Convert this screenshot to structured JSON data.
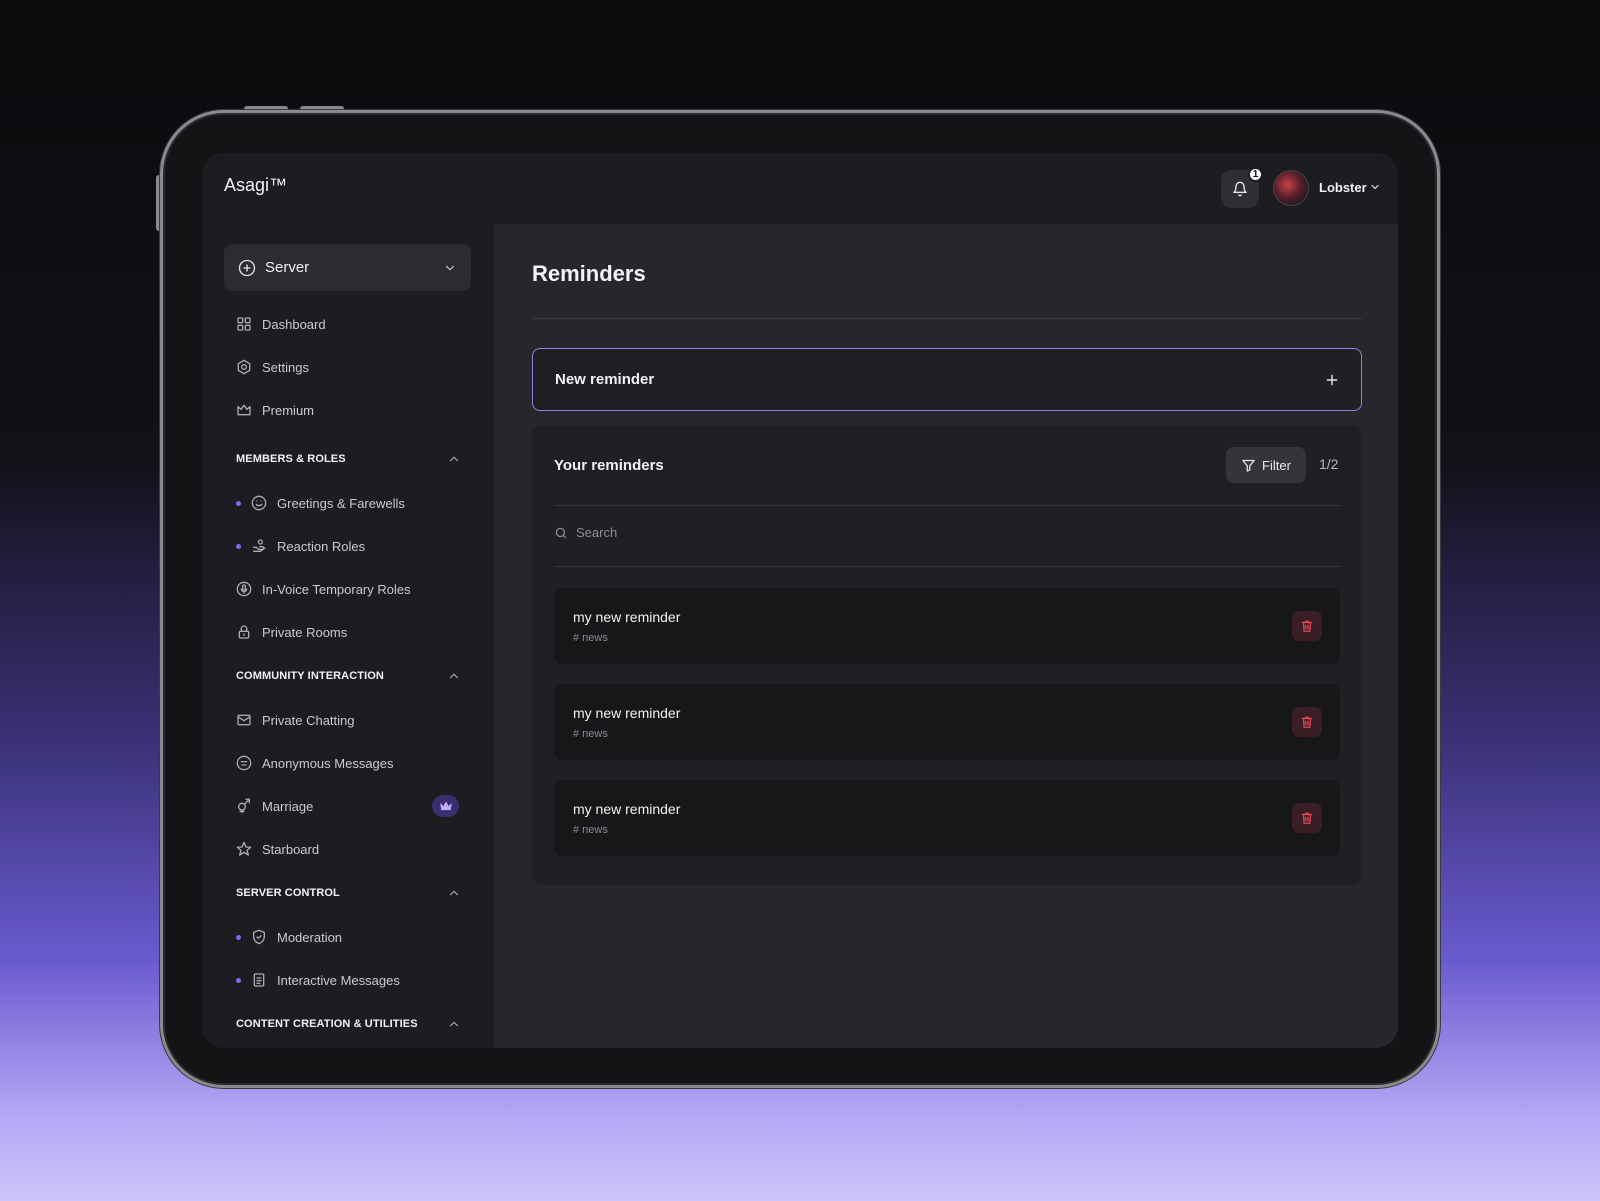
{
  "app": {
    "title": "Asagi™"
  },
  "header": {
    "notification_count": "1",
    "username": "Lobster"
  },
  "sidebar": {
    "server_select": "Server",
    "top_items": [
      {
        "label": "Dashboard",
        "icon": "grid-icon"
      },
      {
        "label": "Settings",
        "icon": "gear-icon"
      },
      {
        "label": "Premium",
        "icon": "crown-icon"
      }
    ],
    "sections": [
      {
        "title": "MEMBERS & ROLES",
        "items": [
          {
            "label": "Greetings & Farewells",
            "icon": "smile-icon",
            "dot": true
          },
          {
            "label": "Reaction Roles",
            "icon": "hand-icon",
            "dot": true
          },
          {
            "label": "In-Voice Temporary Roles",
            "icon": "mic-icon",
            "dot": false
          },
          {
            "label": "Private Rooms",
            "icon": "lock-icon",
            "dot": false
          }
        ]
      },
      {
        "title": "COMMUNITY INTERACTION",
        "items": [
          {
            "label": "Private Chatting",
            "icon": "mail-icon"
          },
          {
            "label": "Anonymous Messages",
            "icon": "anon-icon"
          },
          {
            "label": "Marriage",
            "icon": "gender-icon",
            "premium": true
          },
          {
            "label": "Starboard",
            "icon": "star-icon"
          }
        ]
      },
      {
        "title": "SERVER CONTROL",
        "items": [
          {
            "label": "Moderation",
            "icon": "shield-icon",
            "dot": true
          },
          {
            "label": "Interactive Messages",
            "icon": "document-icon",
            "dot": true
          }
        ]
      },
      {
        "title": "CONTENT CREATION & UTILITIES",
        "items": []
      }
    ]
  },
  "main": {
    "title": "Reminders",
    "new_reminder_label": "New reminder",
    "panel_title": "Your reminders",
    "filter_label": "Filter",
    "pager": "1/2",
    "search_placeholder": "Search",
    "reminders": [
      {
        "name": "my new reminder",
        "channel": "# news"
      },
      {
        "name": "my new reminder",
        "channel": "# news"
      },
      {
        "name": "my new reminder",
        "channel": "# news"
      }
    ]
  },
  "colors": {
    "accent": "#7b6cf0",
    "danger": "#e0485a",
    "screen_bg": "#1d1d21",
    "main_bg": "#26262c"
  }
}
